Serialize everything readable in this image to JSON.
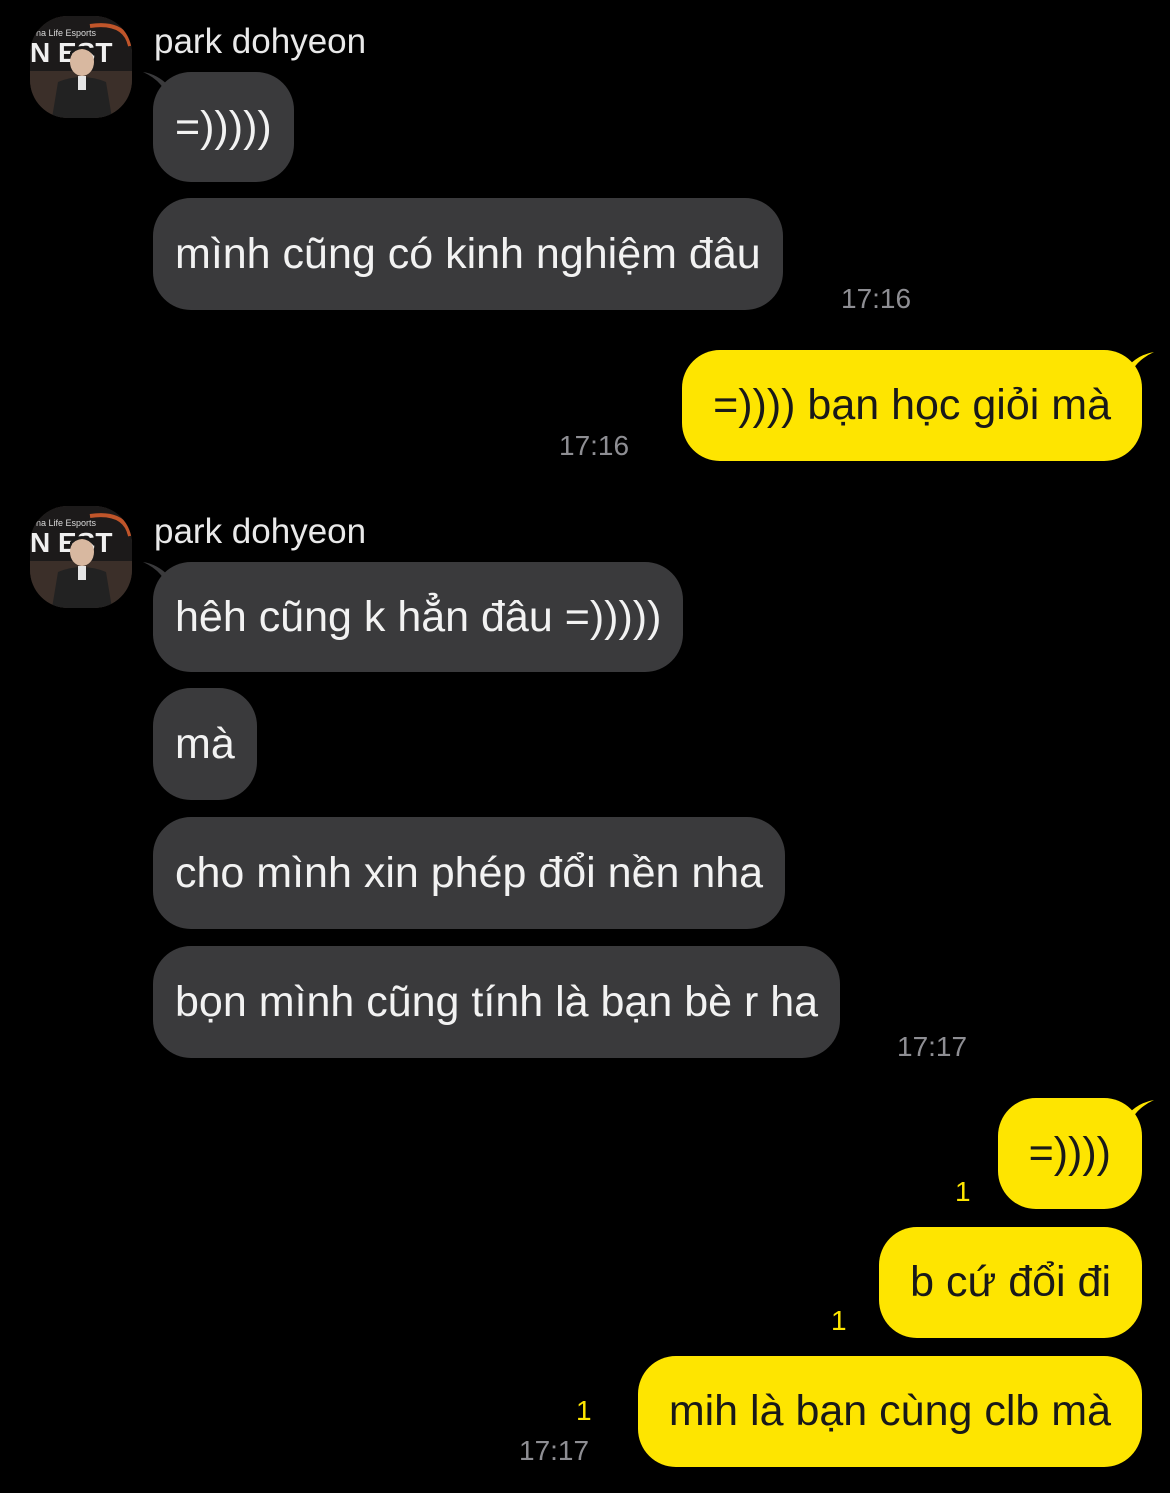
{
  "colors": {
    "background": "#000000",
    "incoming_bubble": "#3a3a3c",
    "outgoing_bubble": "#fee500",
    "timestamp": "#8e8e93",
    "unread_count": "#fee500"
  },
  "groups": [
    {
      "sender": "park dohyeon",
      "avatar": "profile-photo",
      "messages": [
        "=)))))",
        "mình cũng có kinh nghiệm đâu"
      ],
      "time": "17:16"
    },
    {
      "outgoing": true,
      "messages": [
        "=)))) bạn học giỏi mà"
      ],
      "time": "17:16"
    },
    {
      "sender": "park dohyeon",
      "avatar": "profile-photo",
      "messages": [
        "hêh cũng k hẳn đâu =)))))",
        "mà",
        "cho mình xin phép đổi nền nha",
        "bọn mình cũng tính là bạn bè r ha"
      ],
      "time": "17:17"
    },
    {
      "outgoing": true,
      "messages": [
        {
          "text": "=))))",
          "unread": "1"
        },
        {
          "text": "b cứ đổi đi",
          "unread": "1"
        },
        {
          "text": "mih là bạn cùng clb mà",
          "unread": "1"
        }
      ],
      "time": "17:17"
    }
  ]
}
